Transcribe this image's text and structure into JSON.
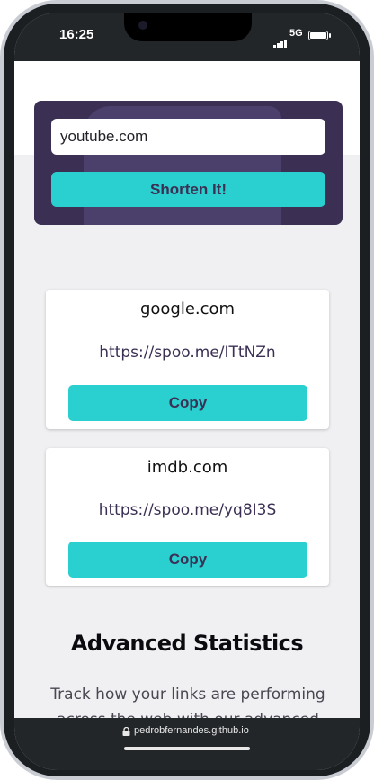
{
  "status_bar": {
    "time": "16:25",
    "network": "5G",
    "signal_icon": "signal-bars-icon",
    "battery_icon": "battery-icon"
  },
  "shorten_form": {
    "input_value": "youtube.com",
    "button_label": "Shorten It!"
  },
  "results": [
    {
      "original": "google.com",
      "short": "https://spoo.me/ITtNZn",
      "copy_label": "Copy"
    },
    {
      "original": "imdb.com",
      "short": "https://spoo.me/yq8I3S",
      "copy_label": "Copy"
    }
  ],
  "stats": {
    "title": "Advanced Statistics",
    "description": "Track how your links are performing across the web with our advanced"
  },
  "browser": {
    "url": "pedrobfernandes.github.io",
    "lock_icon": "lock-icon"
  },
  "colors": {
    "accent_cyan": "#2acfcf",
    "dark_violet": "#3b3054",
    "bg_gray": "#f0f0f2"
  }
}
